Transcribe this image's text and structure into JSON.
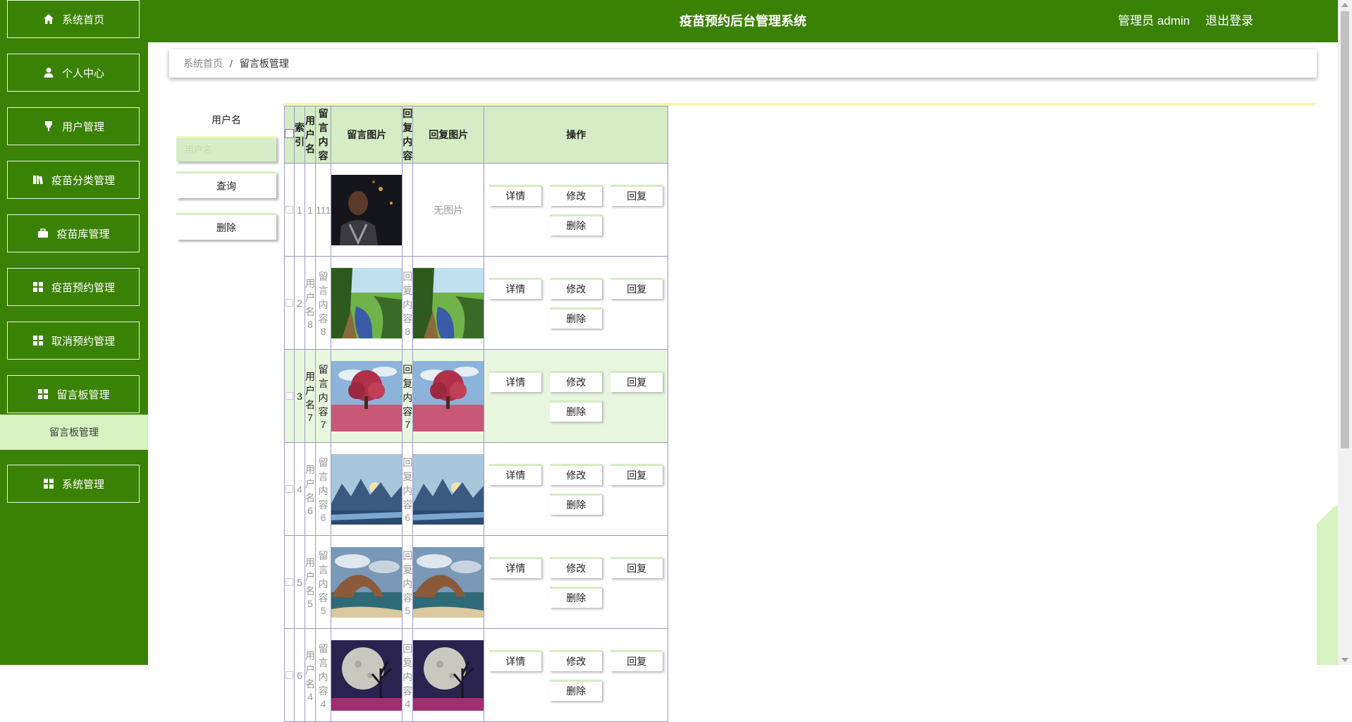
{
  "sidebar": {
    "items": [
      {
        "label": "系统首页",
        "icon": "home-icon"
      },
      {
        "label": "个人中心",
        "icon": "user-icon"
      },
      {
        "label": "用户管理",
        "icon": "pin-icon"
      },
      {
        "label": "疫苗分类管理",
        "icon": "book-icon"
      },
      {
        "label": "疫苗库管理",
        "icon": "briefcase-icon"
      },
      {
        "label": "疫苗预约管理",
        "icon": "grid-icon"
      },
      {
        "label": "取消预约管理",
        "icon": "grid-icon"
      },
      {
        "label": "留言板管理",
        "icon": "grid-icon"
      },
      {
        "label": "系统管理",
        "icon": "grid-icon"
      }
    ],
    "active_sub": "留言板管理"
  },
  "header": {
    "title": "疫苗预约后台管理系统",
    "user": "管理员 admin",
    "logout": "退出登录"
  },
  "breadcrumb": {
    "home": "系统首页",
    "sep": "/",
    "current": "留言板管理"
  },
  "search": {
    "label": "用户名",
    "placeholder": "用户名",
    "query_btn": "查询",
    "delete_btn": "删除"
  },
  "table": {
    "columns": [
      "索引",
      "用户名",
      "留言内容",
      "留言图片",
      "回复内容",
      "回复图片",
      "操作"
    ],
    "ops": [
      "详情",
      "修改",
      "回复",
      "删除"
    ],
    "rows": [
      {
        "index": "1",
        "user": "1",
        "content": "111",
        "img": "portrait",
        "reply": "",
        "reply_img": "none",
        "reply_img_text": "无图片"
      },
      {
        "index": "2",
        "user": "用户名8",
        "content": "留言内容8",
        "img": "forest",
        "reply": "回复内容8",
        "reply_img": "forest",
        "reply_img_text": ""
      },
      {
        "index": "3",
        "user": "用户名7",
        "content": "留言内容7",
        "img": "tree",
        "reply": "回复内容7",
        "reply_img": "tree",
        "reply_img_text": ""
      },
      {
        "index": "4",
        "user": "用户名6",
        "content": "留言内容6",
        "img": "mountain",
        "reply": "回复内容6",
        "reply_img": "mountain",
        "reply_img_text": ""
      },
      {
        "index": "5",
        "user": "用户名5",
        "content": "留言内容5",
        "img": "arch",
        "reply": "回复内容5",
        "reply_img": "arch",
        "reply_img_text": ""
      },
      {
        "index": "6",
        "user": "用户名4",
        "content": "留言内容4",
        "img": "moon",
        "reply": "回复内容4",
        "reply_img": "moon",
        "reply_img_text": ""
      }
    ]
  },
  "colors": {
    "primary": "#3a8206",
    "light": "#d6ecc6",
    "highlight_row": "#e9f6df"
  }
}
